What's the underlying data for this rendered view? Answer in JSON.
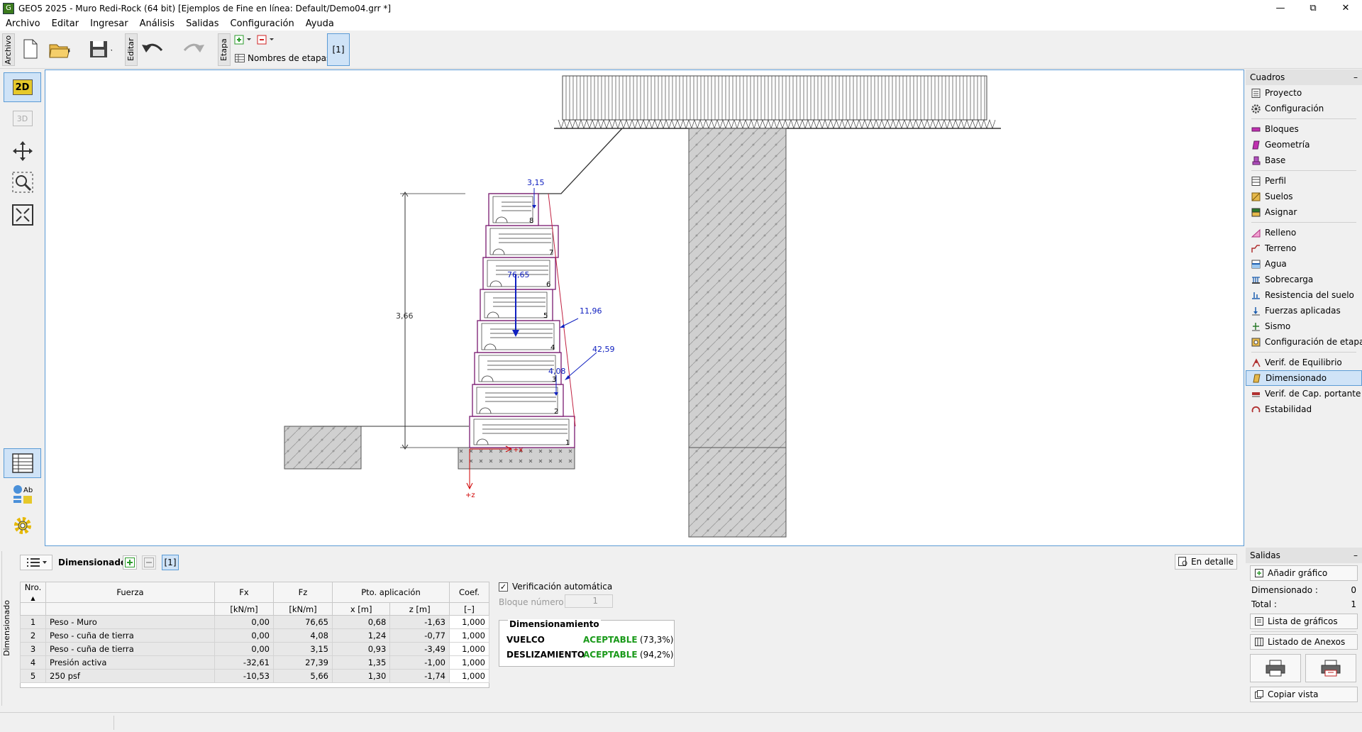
{
  "window": {
    "title": "GEO5 2025 - Muro Redi-Rock  (64 bit) [Ejemplos de Fine en línea: Default/Demo04.grr *]"
  },
  "menu": [
    "Archivo",
    "Editar",
    "Ingresar",
    "Análisis",
    "Salidas",
    "Configuración",
    "Ayuda"
  ],
  "toolbar": {
    "archivo_tab": "Archivo",
    "editar_tab": "Editar",
    "etapa_tab": "Etapa",
    "stage_names": "Nombres de etapas",
    "stage_button": "[1]"
  },
  "left_tools": {
    "mode_2d": "2D",
    "mode_3d": "3D"
  },
  "drawing": {
    "height_dim": "3,66",
    "block_numbers": [
      "1",
      "2",
      "3",
      "4",
      "5",
      "6",
      "7",
      "8"
    ],
    "force_labels": [
      "3,15",
      "76,65",
      "11,96",
      "42,59",
      "4,08"
    ],
    "axis_x": "+x",
    "axis_z": "+z"
  },
  "cuadros": {
    "header": "Cuadros",
    "groups": [
      [
        {
          "label": "Proyecto",
          "icon": "document-icon"
        },
        {
          "label": "Configuración",
          "icon": "gear-icon"
        }
      ],
      [
        {
          "label": "Bloques",
          "icon": "blocks-icon"
        },
        {
          "label": "Geometría",
          "icon": "geometry-icon"
        },
        {
          "label": "Base",
          "icon": "base-icon"
        }
      ],
      [
        {
          "label": "Perfil",
          "icon": "profile-icon"
        },
        {
          "label": "Suelos",
          "icon": "soils-icon"
        },
        {
          "label": "Asignar",
          "icon": "assign-icon"
        }
      ],
      [
        {
          "label": "Relleno",
          "icon": "backfill-icon"
        },
        {
          "label": "Terreno",
          "icon": "terrain-icon"
        },
        {
          "label": "Agua",
          "icon": "water-icon"
        },
        {
          "label": "Sobrecarga",
          "icon": "surcharge-icon"
        },
        {
          "label": "Resistencia del suelo",
          "icon": "resistance-icon"
        },
        {
          "label": "Fuerzas aplicadas",
          "icon": "forces-icon"
        },
        {
          "label": "Sismo",
          "icon": "earthquake-icon"
        },
        {
          "label": "Configuración de etapa",
          "icon": "stage-settings-icon"
        }
      ],
      [
        {
          "label": "Verif. de Equilibrio",
          "icon": "equilibrium-icon"
        },
        {
          "label": "Dimensionado",
          "icon": "dimensioning-icon",
          "active": true
        },
        {
          "label": "Verif. de Cap. portante",
          "icon": "bearing-icon"
        },
        {
          "label": "Estabilidad",
          "icon": "stability-icon"
        }
      ]
    ]
  },
  "bottom": {
    "side_label": "Dimensionado",
    "header_label": "Dimensionado :",
    "stage_btn": "[1]",
    "detail_btn": "En detalle",
    "table": {
      "headers": [
        "Nro.",
        "Fuerza",
        "Fx",
        "Fz",
        "Pto. aplicación",
        "Coef."
      ],
      "subheaders": [
        "",
        "",
        "[kN/m]",
        "[kN/m]",
        "x [m]",
        "z [m]",
        "[–]"
      ],
      "rows": [
        [
          "1",
          "Peso - Muro",
          "0,00",
          "76,65",
          "0,68",
          "-1,63",
          "1,000"
        ],
        [
          "2",
          "Peso - cuña de tierra",
          "0,00",
          "4,08",
          "1,24",
          "-0,77",
          "1,000"
        ],
        [
          "3",
          "Peso - cuña de tierra",
          "0,00",
          "3,15",
          "0,93",
          "-3,49",
          "1,000"
        ],
        [
          "4",
          "Presión activa",
          "-32,61",
          "27,39",
          "1,35",
          "-1,00",
          "1,000"
        ],
        [
          "5",
          "250 psf",
          "-10,53",
          "5,66",
          "1,30",
          "-1,74",
          "1,000"
        ]
      ]
    },
    "auto_check": "Verificación automática",
    "block_label": "Bloque número :",
    "block_value": "1",
    "result_title": "Dimensionamiento",
    "results": [
      {
        "name": "VUELCO",
        "status": "ACEPTABLE",
        "pct": "(73,3%)"
      },
      {
        "name": "DESLIZAMIENTO",
        "status": "ACEPTABLE",
        "pct": "(94,2%)"
      }
    ]
  },
  "salidas": {
    "header": "Salidas",
    "add_btn": "Añadir gráfico",
    "dim_label": "Dimensionado :",
    "dim_value": "0",
    "total_label": "Total :",
    "total_value": "1",
    "list_btn": "Lista de gráficos",
    "annex_btn": "Listado de Anexos",
    "copy_btn": "Copiar vista"
  }
}
